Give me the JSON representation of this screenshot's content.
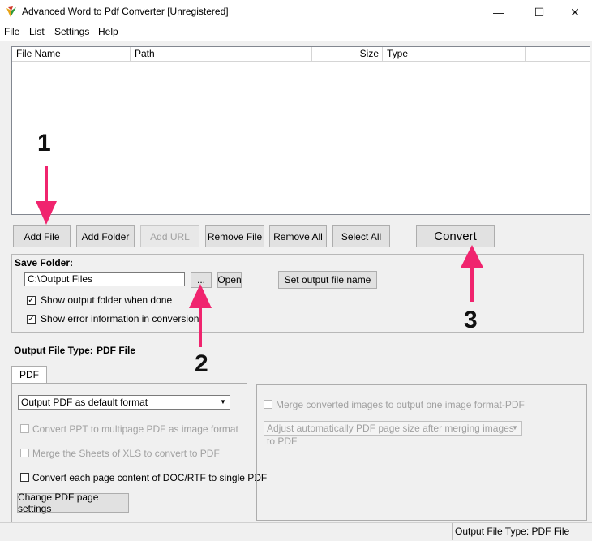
{
  "window": {
    "title": "Advanced Word to Pdf Converter [Unregistered]",
    "minimize": "—",
    "maximize": "☐",
    "close": "✕"
  },
  "menu": [
    "File",
    "List",
    "Settings",
    "Help"
  ],
  "file_list": {
    "columns": [
      "File Name",
      "Path",
      "Size",
      "Type"
    ]
  },
  "buttons": {
    "add_file": "Add File",
    "add_folder": "Add Folder",
    "add_url": "Add URL",
    "remove_file": "Remove File",
    "remove_all": "Remove All",
    "select_all": "Select All",
    "convert": "Convert"
  },
  "save_folder": {
    "label": "Save Folder:",
    "path": "C:\\Output Files",
    "browse": "...",
    "open": "Open",
    "set_output_name": "Set output file name",
    "show_output_folder": "Show output folder when done",
    "show_error_info": "Show error information in conversion"
  },
  "output_type": {
    "label": "Output File Type:",
    "value": "PDF File"
  },
  "tabs": [
    "PDF"
  ],
  "pdf_options": {
    "format_select": "Output PDF as default format",
    "convert_ppt": "Convert PPT to multipage PDF as image format",
    "merge_xls": "Merge the Sheets of XLS to convert to PDF",
    "convert_each_page": "Convert each page content of DOC/RTF to single PDF",
    "change_settings": "Change PDF page settings"
  },
  "image_options": {
    "merge_images": "Merge converted images to output one image format-PDF",
    "page_size_select": "Adjust automatically PDF page size after merging images to PDF"
  },
  "statusbar": {
    "text": "Output File Type:  PDF File"
  },
  "annotations": [
    "1",
    "2",
    "3"
  ],
  "colors": {
    "arrow": "#f0246e"
  }
}
